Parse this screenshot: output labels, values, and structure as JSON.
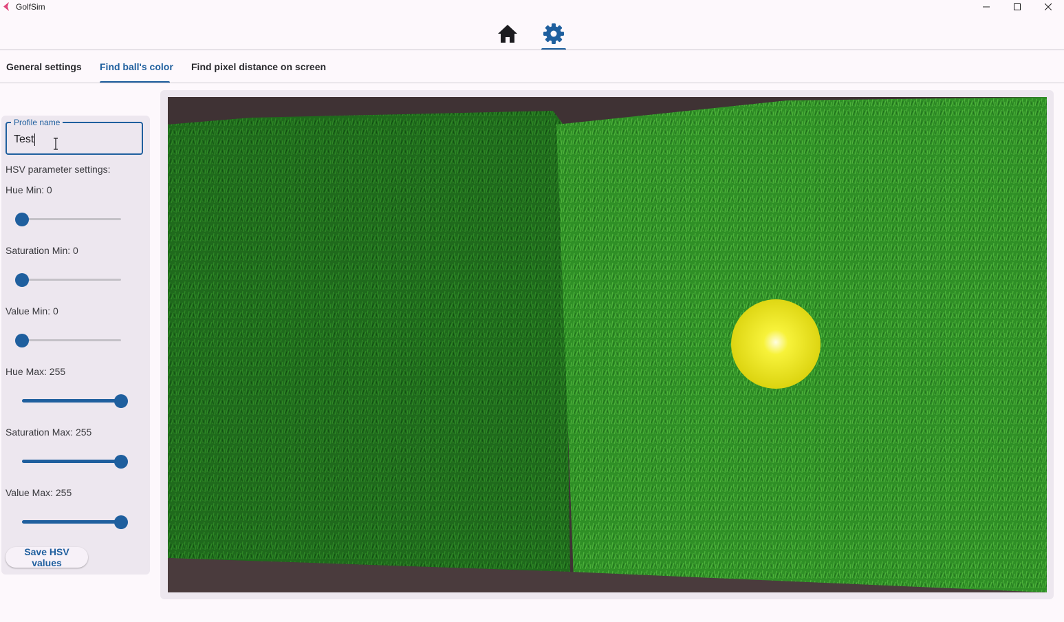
{
  "window": {
    "title": "GolfSim",
    "colors": {
      "accent": "#1f5f9e",
      "background": "#fdf8fc",
      "panel": "#ede7ef",
      "logo": "#e0457b"
    }
  },
  "topnav": {
    "items": [
      {
        "icon": "home-icon"
      },
      {
        "icon": "settings-icon",
        "selected": true
      }
    ]
  },
  "tabs": [
    {
      "label": "General settings"
    },
    {
      "label": "Find ball's color",
      "selected": true
    },
    {
      "label": "Find pixel distance on screen"
    }
  ],
  "profile": {
    "label": "Profile name",
    "value": "Test"
  },
  "hsv": {
    "heading": "HSV parameter settings:",
    "sliders": [
      {
        "label": "Hue Min: 0",
        "value": 0,
        "min": 0,
        "max": 255
      },
      {
        "label": "Saturation Min: 0",
        "value": 0,
        "min": 0,
        "max": 255
      },
      {
        "label": "Value Min: 0",
        "value": 0,
        "min": 0,
        "max": 255
      },
      {
        "label": "Hue Max: 255",
        "value": 255,
        "min": 0,
        "max": 255
      },
      {
        "label": "Saturation Max: 255",
        "value": 255,
        "min": 0,
        "max": 255
      },
      {
        "label": "Value Max: 255",
        "value": 255,
        "min": 0,
        "max": 255
      }
    ],
    "save_label": "Save HSV values"
  },
  "preview": {
    "description_icon": "camera-feed",
    "ball_color": "#f2ec1a"
  }
}
